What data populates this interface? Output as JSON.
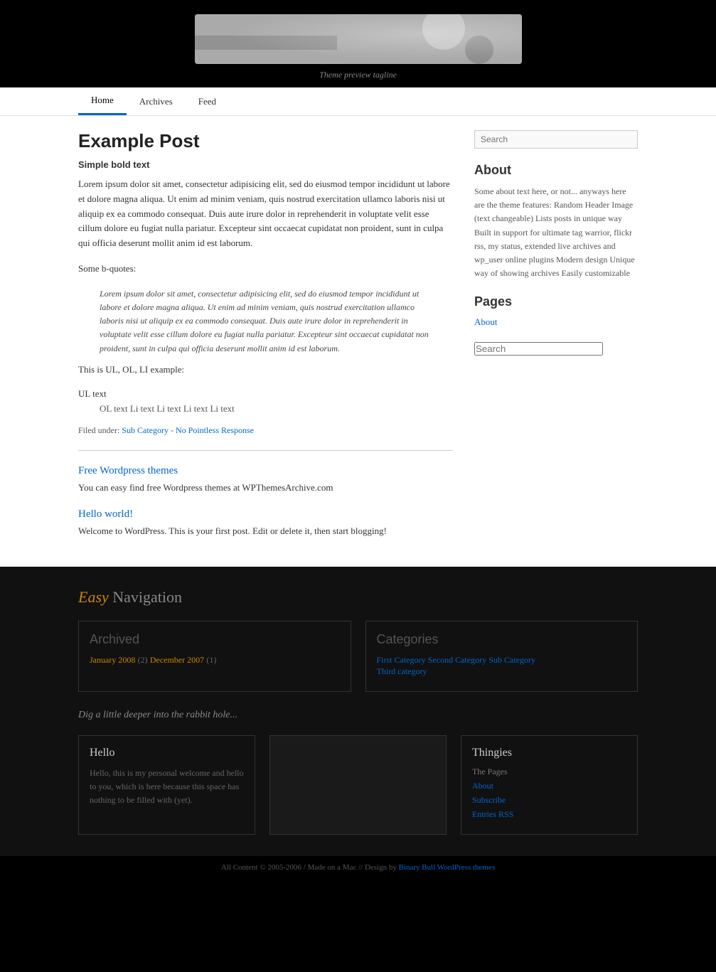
{
  "header": {
    "tagline": "Theme preview tagline"
  },
  "nav": {
    "items": [
      {
        "label": "Home",
        "active": true
      },
      {
        "label": "Archives",
        "active": false
      },
      {
        "label": "Feed",
        "active": false
      }
    ]
  },
  "sidebar_top": {
    "search_placeholder": "Search",
    "about_title": "About",
    "about_text": "Some about text here, or not... anyways here are the theme features: Random Header Image (text changeable) Lists posts in unique way Built in support for ultimate tag warrior, flickr rss, my status, extended live archives and wp_user online plugins Modern design Unique way of showing archives Easily customizable",
    "pages_title": "Pages",
    "pages_link": "About"
  },
  "main_post": {
    "title": "Example Post",
    "subtitle": "Simple bold text",
    "body1": "Lorem ipsum dolor sit amet, consectetur adipisicing elit, sed do eiusmod tempor incididunt ut labore et dolore magna aliqua. Ut enim ad minim veniam, quis nostrud exercitation ullamco laboris nisi ut aliquip ex ea commodo consequat. Duis aute irure dolor in reprehenderit in voluptate velit esse cillum dolore eu fugiat nulla pariatur. Excepteur sint occaecat cupidatat non proident, sunt in culpa qui officia deserunt mollit anim id est laborum.",
    "some_bquotes": "Some b-quotes:",
    "blockquote": "Lorem ipsum dolor sit amet, consectetur adipisicing elit, sed do eiusmod tempor incididunt ut labore et dolore magna aliqua. Ut enim ad minim veniam, quis nostrud exercitation ullamco laboris nisi ut aliquip ex ea commodo consequat. Duis aute irure dolor in reprehenderit in voluptate velit esse cillum dolore eu fugiat nulla pariatur. Excepteur sint occaecat cupidatat non proident, sunt in culpa qui officia deserunt mollit anim id est laborum.",
    "ul_label": "This is UL, OL, LI example:",
    "ul_text": "UL text",
    "ol_text": "OL text  Li text  Li text  Li text  Li text",
    "filed_under_label": "Filed under:",
    "filed_links": [
      {
        "text": "Sub Category",
        "href": "#"
      },
      {
        "text": "No Pointless Response",
        "href": "#"
      }
    ]
  },
  "secondary_posts": [
    {
      "title": "Free Wordpress themes",
      "href": "#",
      "body": "You can easy find free Wordpress themes at WPThemesArchive.com"
    },
    {
      "title": "Hello world!",
      "href": "#",
      "body": "Welcome to WordPress. This is your first post. Edit or delete it, then start blogging!"
    }
  ],
  "sidebar_bottom": {
    "search_placeholder": "Search"
  },
  "footer": {
    "easy_nav_easy": "Easy",
    "easy_nav_navigation": " Navigation",
    "archived_title": "Archived",
    "archive_items": [
      {
        "label": "January 2008",
        "count": "(2)"
      },
      {
        "label": "December 2007",
        "count": "(1)"
      }
    ],
    "categories_title": "Categories",
    "category_links": [
      {
        "label": "First Category"
      },
      {
        "label": "Second Category"
      },
      {
        "label": "Sub Category"
      },
      {
        "label": "Third category"
      }
    ],
    "dig_deeper": "Dig a little deeper into the rabbit hole...",
    "hello_box": {
      "title": "Hello",
      "body": "Hello, this is my personal welcome and hello to you, which is here because this space has nothing to be filled with (yet)."
    },
    "thingies_box": {
      "title": "Thingies",
      "pages_label": "The Pages",
      "links": [
        {
          "label": "About"
        },
        {
          "label": "Subscribe"
        },
        {
          "label": "Entries RSS"
        }
      ]
    }
  },
  "footer_bottom": {
    "text": "All Content © 2005-2006 / Made on a Mac // Design by",
    "link_text": "Binary Bull WordPress themes",
    "link_href": "#"
  }
}
